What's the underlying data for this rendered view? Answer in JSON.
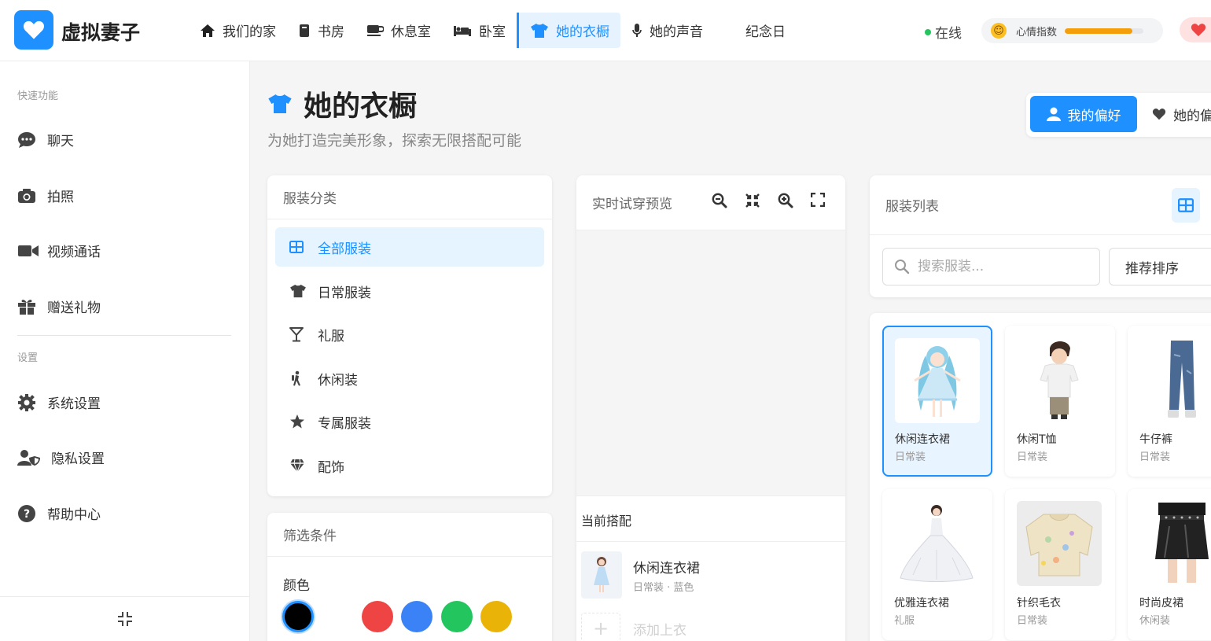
{
  "app": {
    "title": "虚拟妻子"
  },
  "nav": [
    {
      "label": "我们的家",
      "icon": "home-icon"
    },
    {
      "label": "书房",
      "icon": "book-icon"
    },
    {
      "label": "休息室",
      "icon": "coffee-icon"
    },
    {
      "label": "卧室",
      "icon": "bed-icon"
    },
    {
      "label": "她的衣橱",
      "icon": "shirt-icon",
      "active": true
    },
    {
      "label": "她的声音",
      "icon": "microphone-icon"
    },
    {
      "label": "纪念日",
      "icon": ""
    }
  ],
  "status": {
    "online": "在线",
    "mood_label": "心情指数",
    "mood_level": 0.86
  },
  "sidebar": {
    "quick_title": "快速功能",
    "quick": [
      {
        "label": "聊天",
        "icon": "chat-icon"
      },
      {
        "label": "拍照",
        "icon": "camera-icon"
      },
      {
        "label": "视频通话",
        "icon": "video-icon"
      },
      {
        "label": "赠送礼物",
        "icon": "gift-icon"
      }
    ],
    "settings_title": "设置",
    "settings": [
      {
        "label": "系统设置",
        "icon": "gear-icon"
      },
      {
        "label": "隐私设置",
        "icon": "user-shield-icon"
      },
      {
        "label": "帮助中心",
        "icon": "question-icon"
      }
    ]
  },
  "page": {
    "title": "她的衣橱",
    "subtitle": "为她打造完美形象，探索无限搭配可能",
    "tabs": [
      "我的偏好",
      "她的偏好"
    ]
  },
  "categories": {
    "title": "服装分类",
    "items": [
      {
        "label": "全部服装",
        "icon": "grid-icon",
        "active": true
      },
      {
        "label": "日常服装",
        "icon": "shirt-icon"
      },
      {
        "label": "礼服",
        "icon": "cocktail-icon"
      },
      {
        "label": "休闲装",
        "icon": "hiking-icon"
      },
      {
        "label": "专属服装",
        "icon": "star-icon"
      },
      {
        "label": "配饰",
        "icon": "gem-icon"
      }
    ]
  },
  "filters": {
    "title": "筛选条件",
    "color_label": "颜色",
    "colors": [
      "#000000",
      "#ffffff",
      "#ef4444",
      "#3b82f6",
      "#22c55e",
      "#eab308"
    ]
  },
  "preview": {
    "title": "实时试穿预览",
    "outfit_title": "当前搭配",
    "current": {
      "name": "休闲连衣裙",
      "meta": "日常装 · 蓝色"
    },
    "add_label": "添加上衣"
  },
  "list": {
    "title": "服装列表",
    "search_placeholder": "搜索服装...",
    "sort": "推荐排序",
    "items": [
      {
        "name": "休闲连衣裙",
        "category": "日常装",
        "selected": true
      },
      {
        "name": "休闲T恤",
        "category": "日常装"
      },
      {
        "name": "牛仔裤",
        "category": "日常装"
      },
      {
        "name": "优雅连衣裙",
        "category": "礼服"
      },
      {
        "name": "针织毛衣",
        "category": "日常装"
      },
      {
        "name": "时尚皮裙",
        "category": "休闲装"
      }
    ]
  },
  "colors": {
    "accent": "#1e90ff"
  }
}
